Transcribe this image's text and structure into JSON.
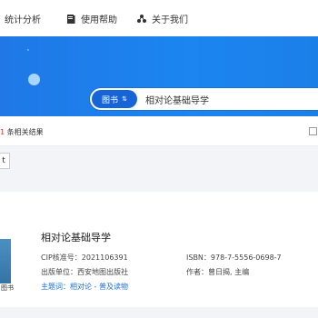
{
  "nav": {
    "items": [
      {
        "label": "统计分析",
        "icon": "chart-icon"
      },
      {
        "label": "使用帮助",
        "icon": "book-icon"
      },
      {
        "label": "关于我们",
        "icon": "share-icon"
      }
    ]
  },
  "search": {
    "type_label": "图书",
    "type_arrows": "⇅",
    "value": "相对论基础导学"
  },
  "results": {
    "count_num": "1",
    "count_suffix": " 条相关结果"
  },
  "sort": {
    "label": "t"
  },
  "book": {
    "title": "相对论基础导学",
    "cip_label": "CIP核准号：",
    "cip_value": "2021106391",
    "isbn_label": "ISBN：",
    "isbn_value": "978-7-5556-0698-7",
    "publisher_label": "出版单位：",
    "publisher_value": "西安地图出版社",
    "author_label": "作者：",
    "author_value": "曾日揭, 主编",
    "subject_label": "主题词：",
    "subject_value": "相对论 - 普及读物",
    "thumb_label": "图书"
  },
  "colors": {
    "accent": "#1a6fd8",
    "banner": "#1c85f0",
    "highlight": "#e53c2b"
  }
}
